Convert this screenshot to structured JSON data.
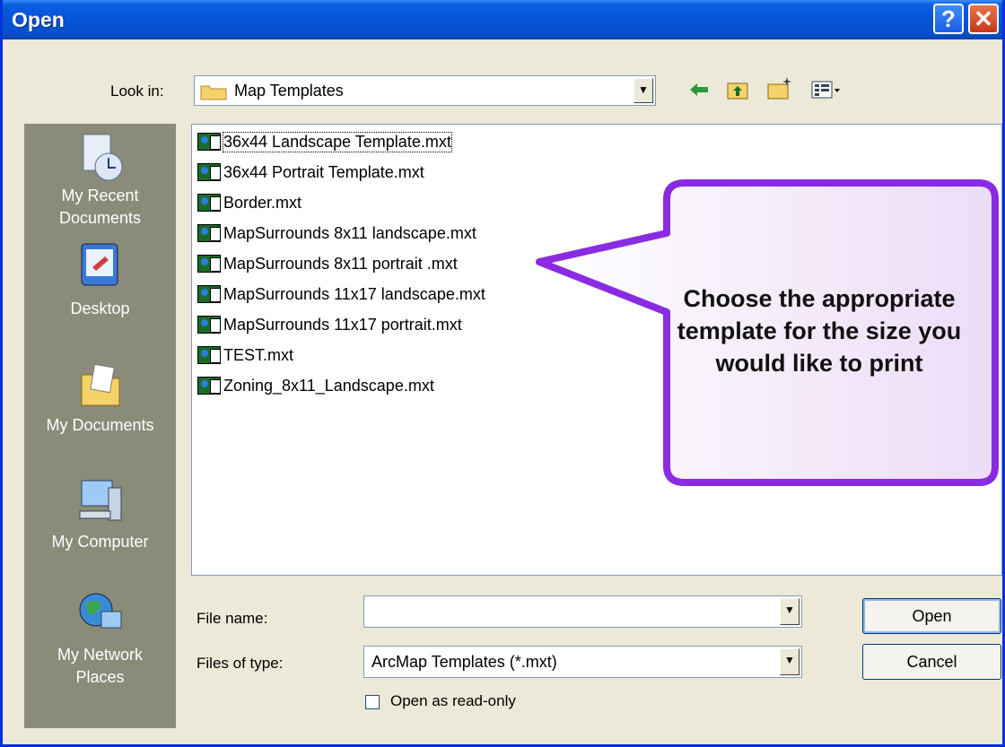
{
  "window": {
    "title": "Open",
    "help_icon": "?",
    "close_icon": "✕"
  },
  "lookin": {
    "label": "Look in:",
    "value": "Map Templates"
  },
  "places": [
    {
      "label_line1": "My Recent",
      "label_line2": "Documents",
      "icon": "recent-documents-icon"
    },
    {
      "label_line1": "Desktop",
      "label_line2": "",
      "icon": "desktop-icon"
    },
    {
      "label_line1": "My Documents",
      "label_line2": "",
      "icon": "my-documents-icon"
    },
    {
      "label_line1": "My Computer",
      "label_line2": "",
      "icon": "my-computer-icon"
    },
    {
      "label_line1": "My Network",
      "label_line2": "Places",
      "icon": "network-places-icon"
    }
  ],
  "files": [
    "36x44 Landscape Template.mxt",
    "36x44 Portrait Template.mxt",
    "Border.mxt",
    "MapSurrounds 8x11 landscape.mxt",
    "MapSurrounds 8x11 portrait .mxt",
    "MapSurrounds 11x17 landscape.mxt",
    "MapSurrounds 11x17 portrait.mxt",
    "TEST.mxt",
    "Zoning_8x11_Landscape.mxt"
  ],
  "callout": "Choose the appropriate template for the size you would like to print",
  "filename": {
    "label": "File name:",
    "value": ""
  },
  "filetype": {
    "label": "Files of type:",
    "value": "ArcMap Templates (*.mxt)"
  },
  "readonly": {
    "label": "Open as read-only",
    "checked": false
  },
  "buttons": {
    "open": "Open",
    "cancel": "Cancel"
  },
  "colors": {
    "titlebar": "#0553d8",
    "places_bg": "#8b8b7a",
    "callout_border": "#8a2be2"
  }
}
